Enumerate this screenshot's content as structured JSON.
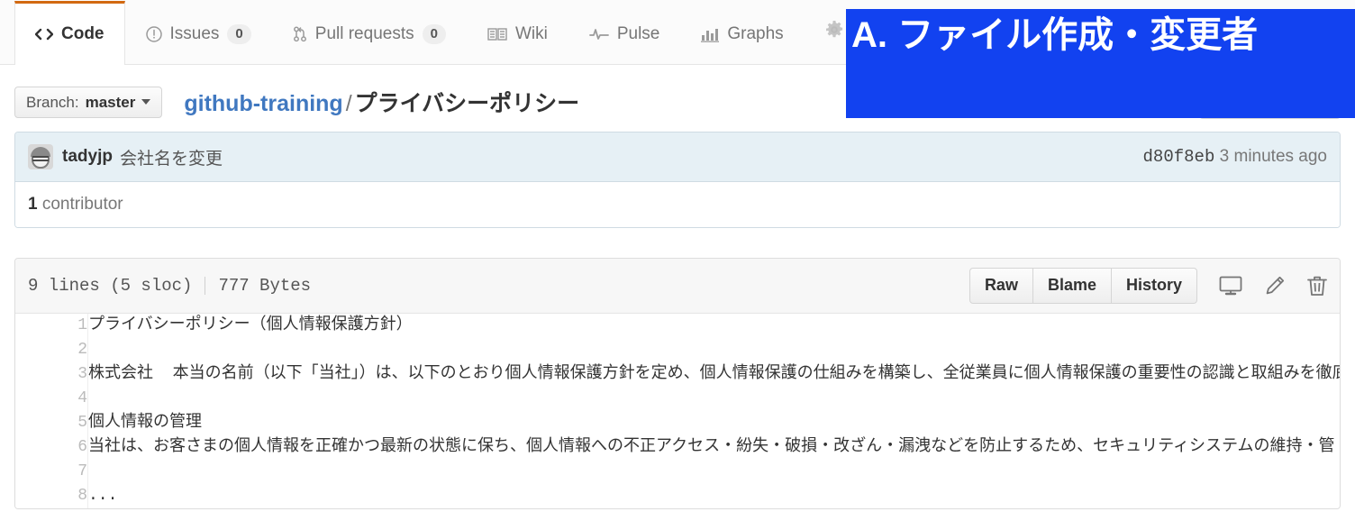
{
  "repo_nav": {
    "tabs": [
      {
        "label": "Code",
        "icon": "code-icon",
        "count": null,
        "selected": true
      },
      {
        "label": "Issues",
        "icon": "issue-opened-icon",
        "count": "0",
        "selected": false
      },
      {
        "label": "Pull requests",
        "icon": "git-pull-request-icon",
        "count": "0",
        "selected": false
      },
      {
        "label": "Wiki",
        "icon": "book-icon",
        "count": null,
        "selected": false
      },
      {
        "label": "Pulse",
        "icon": "pulse-icon",
        "count": null,
        "selected": false
      },
      {
        "label": "Graphs",
        "icon": "graph-icon",
        "count": null,
        "selected": false
      }
    ],
    "settings_icon": "gear-icon"
  },
  "file_head": {
    "branch_prefix": "Branch:",
    "branch_name": "master",
    "repo_name": "github-training",
    "path_separator": "/",
    "file_name": "プライバシーポリシー"
  },
  "commit": {
    "author": "tadyjp",
    "message": "会社名を変更",
    "sha": "d80f8eb",
    "time": "3 minutes ago",
    "contributor_count": "1",
    "contributor_label": "contributor"
  },
  "blob": {
    "lines_info": "9 lines (5 sloc)",
    "size": "777 Bytes",
    "buttons": [
      {
        "label": "Raw"
      },
      {
        "label": "Blame"
      },
      {
        "label": "History"
      }
    ],
    "icons": [
      {
        "name": "desktop-download-icon"
      },
      {
        "name": "pencil-edit-icon"
      },
      {
        "name": "trash-delete-icon"
      }
    ],
    "code_lines": [
      {
        "n": "1",
        "text": "プライバシーポリシー（個人情報保護方針）"
      },
      {
        "n": "2",
        "text": ""
      },
      {
        "n": "3",
        "text": "株式会社  本当の名前（以下「当社」）は、以下のとおり個人情報保護方針を定め、個人情報保護の仕組みを構築し、全従業員に個人情報保護の重要性の認識と取組みを徹底"
      },
      {
        "n": "4",
        "text": ""
      },
      {
        "n": "5",
        "text": "個人情報の管理"
      },
      {
        "n": "6",
        "text": "当社は、お客さまの個人情報を正確かつ最新の状態に保ち、個人情報への不正アクセス・紛失・破損・改ざん・漏洩などを防止するため、セキュリティシステムの維持・管"
      },
      {
        "n": "7",
        "text": ""
      },
      {
        "n": "8",
        "text": "..."
      }
    ]
  },
  "annotation": {
    "text": "A. ファイル作成・変更者",
    "background_color": "#1242f0",
    "text_color": "#ffffff"
  },
  "colors": {
    "accent_orange": "#d26911",
    "link_blue": "#4078c0",
    "commit_bar_bg": "#e6f0f5"
  }
}
